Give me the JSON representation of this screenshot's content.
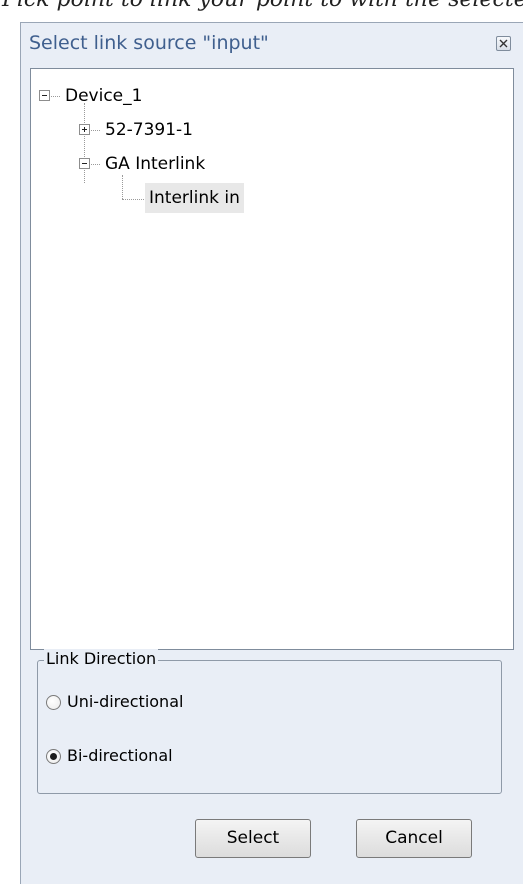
{
  "background_text": "Pick point to link your point to with the selected point",
  "dialog": {
    "title": "Select link source \"input\"",
    "close_icon": "close-icon"
  },
  "tree": {
    "root": {
      "label": "Device_1",
      "state": "expanded",
      "children": [
        {
          "label": "52-7391-1",
          "state": "collapsed"
        },
        {
          "label": "GA Interlink",
          "state": "expanded",
          "children": [
            {
              "label": "Interlink in",
              "selected": true
            }
          ]
        }
      ]
    }
  },
  "link_direction": {
    "title": "Link Direction",
    "options": [
      {
        "label": "Uni-directional",
        "checked": false
      },
      {
        "label": "Bi-directional",
        "checked": true
      }
    ]
  },
  "buttons": {
    "select_label": "Select",
    "cancel_label": "Cancel"
  }
}
